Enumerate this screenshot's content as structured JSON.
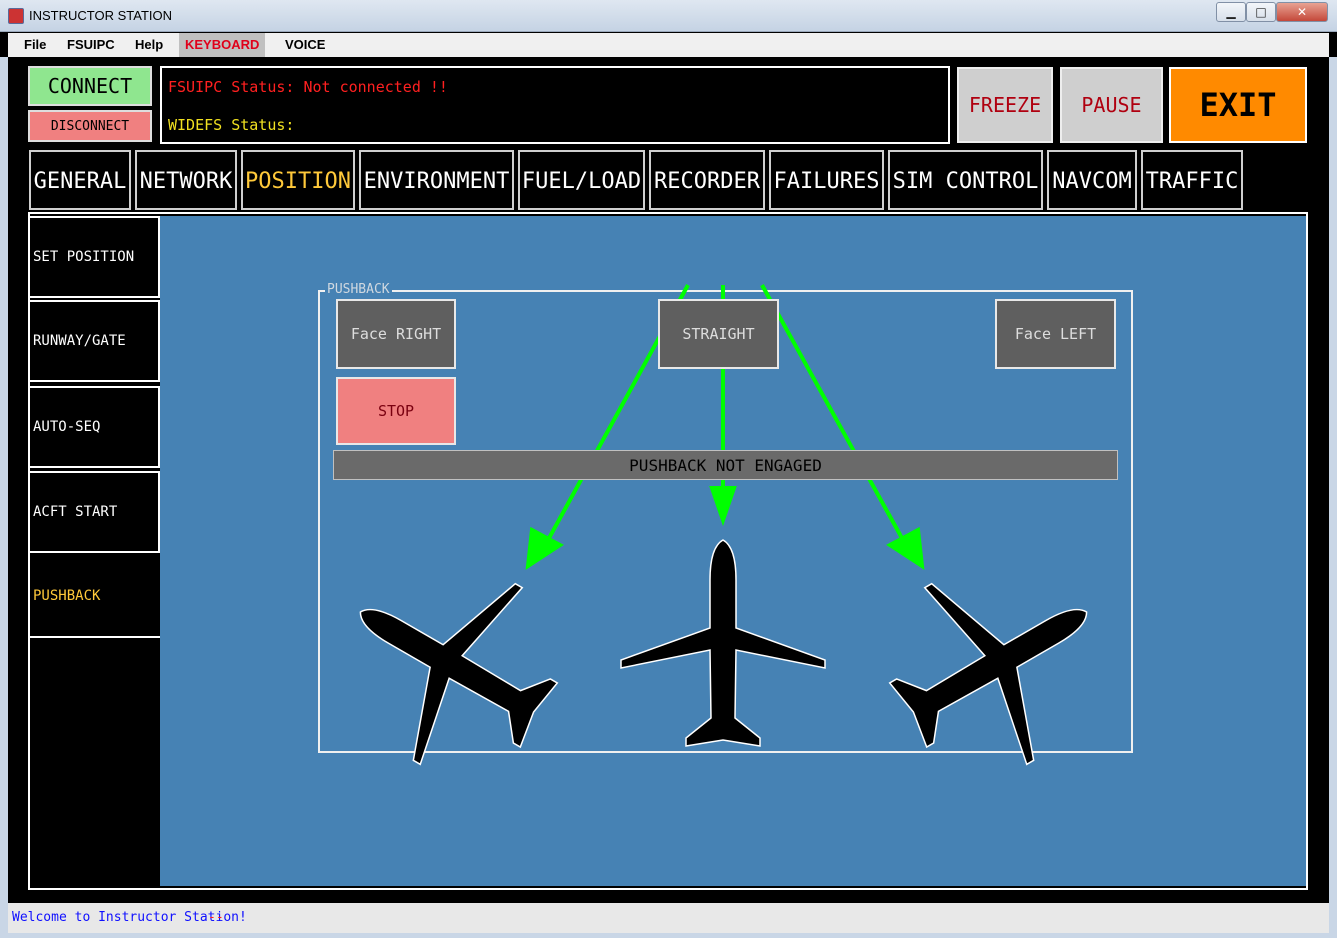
{
  "window": {
    "title": "INSTRUCTOR STATION",
    "min_icon": "minimize-icon",
    "max_icon": "maximize-icon",
    "close_icon": "close-icon",
    "min": "▁",
    "max": "□",
    "close": "✕"
  },
  "menu": [
    "File",
    "FSUIPC",
    "Help",
    "KEYBOARD",
    "VOICE"
  ],
  "connect": {
    "connect_label": "CONNECT",
    "disconnect_label": "DISCONNECT"
  },
  "status": {
    "fsuipc": "FSUIPC Status: Not connected !!",
    "widefs": "WIDEFS Status:"
  },
  "controls": {
    "freeze": "FREEZE",
    "pause": "PAUSE",
    "exit": "EXIT"
  },
  "tabs": [
    "GENERAL",
    "NETWORK",
    "POSITION",
    "ENVIRONMENT",
    "FUEL/LOAD",
    "RECORDER",
    "FAILURES",
    "SIM CONTROL",
    "NAVCOM",
    "TRAFFIC"
  ],
  "active_tab": "POSITION",
  "sidebar": [
    "SET POSITION",
    "RUNWAY/GATE",
    "AUTO-SEQ",
    "ACFT START",
    "PUSHBACK"
  ],
  "active_side": "PUSHBACK",
  "pushback": {
    "legend": "PUSHBACK",
    "face_right": "Face RIGHT",
    "straight": "STRAIGHT",
    "face_left": "Face LEFT",
    "stop": "STOP",
    "status": "PUSHBACK NOT ENGAGED"
  },
  "footer": {
    "welcome": "Welcome to Instructor Station!",
    "dash": "--"
  },
  "colors": {
    "panel": "#4682b4",
    "arrow": "#00ff00",
    "accent": "#ffc93a",
    "exit": "#ff8a00"
  }
}
